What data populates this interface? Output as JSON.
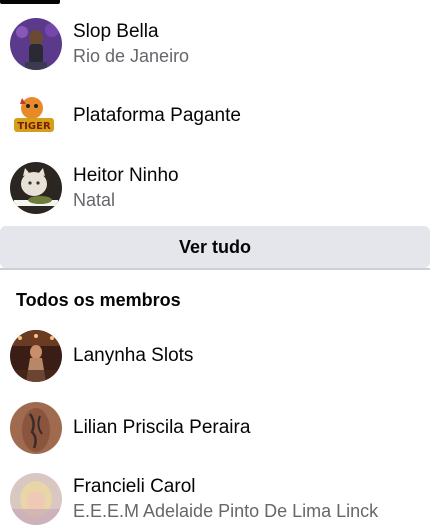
{
  "friends_section": {
    "items": [
      {
        "name": "Slop Bella",
        "subtitle": "Rio de Janeiro",
        "avatar_icon": "woman-avatar"
      },
      {
        "name": "Plataforma Pagante",
        "subtitle": "",
        "avatar_icon": "fortune-tiger-logo"
      },
      {
        "name": "Heitor Ninho",
        "subtitle": "Natal",
        "avatar_icon": "cat-meme-avatar"
      }
    ],
    "see_all_label": "Ver tudo"
  },
  "all_members": {
    "title": "Todos os membros",
    "items": [
      {
        "name": "Lanynha Slots",
        "subtitle": "",
        "avatar_icon": "casino-avatar"
      },
      {
        "name": "Lilian Priscila Peraira",
        "subtitle": "",
        "avatar_icon": "tattoo-avatar"
      },
      {
        "name": "Francieli Carol",
        "subtitle": "E.E.E.M Adelaide Pinto De Lima Linck",
        "avatar_icon": "blonde-avatar"
      }
    ]
  },
  "colors": {
    "button_bg": "#e4e6eb",
    "secondary_text": "#65676b",
    "divider": "#ccd0d5"
  }
}
